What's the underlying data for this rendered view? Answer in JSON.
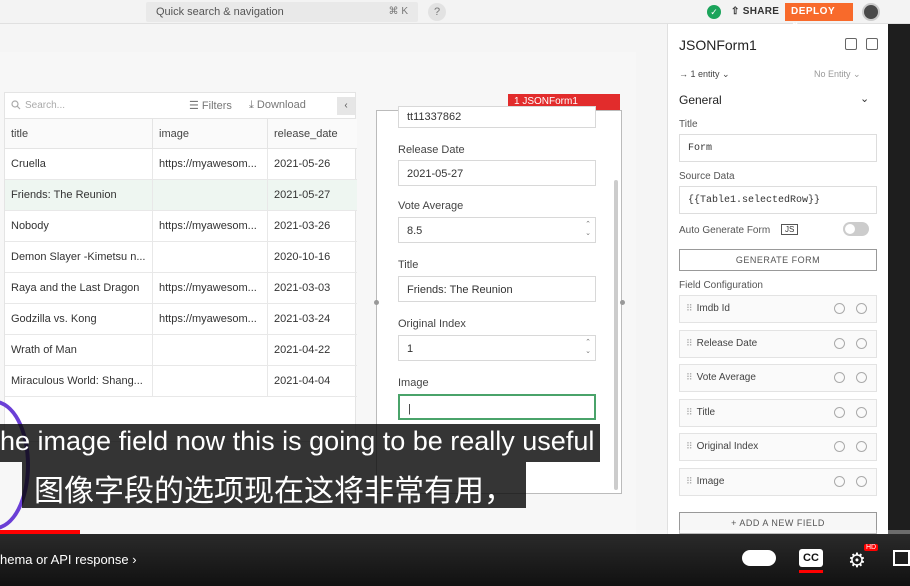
{
  "topbar": {
    "search_placeholder": "Quick search & navigation",
    "search_shortcut": "⌘ K",
    "help": "?",
    "share_label": "SHARE",
    "deploy_label": "DEPLOY"
  },
  "table": {
    "search_placeholder": "Search...",
    "filters_label": "Filters",
    "download_label": "Download",
    "columns": [
      "title",
      "image",
      "release_date"
    ],
    "rows": [
      {
        "title": "Cruella",
        "image": "https://myawesom...",
        "release_date": "2021-05-26"
      },
      {
        "title": "Friends: The Reunion",
        "image": "",
        "release_date": "2021-05-27"
      },
      {
        "title": "Nobody",
        "image": "https://myawesom...",
        "release_date": "2021-03-26"
      },
      {
        "title": "Demon Slayer -Kimetsu n...",
        "image": "",
        "release_date": "2020-10-16"
      },
      {
        "title": "Raya and the Last Dragon",
        "image": "https://myawesom...",
        "release_date": "2021-03-03"
      },
      {
        "title": "Godzilla vs. Kong",
        "image": "https://myawesom...",
        "release_date": "2021-03-24"
      },
      {
        "title": "Wrath of Man",
        "image": "",
        "release_date": "2021-04-22"
      },
      {
        "title": "Miraculous World: Shang...",
        "image": "",
        "release_date": "2021-04-04"
      }
    ],
    "selected_row_index": 1
  },
  "form": {
    "badge_label": "1  JSONForm1",
    "imdb_value": "tt11337862",
    "release_date_label": "Release Date",
    "release_date_value": "2021-05-27",
    "vote_average_label": "Vote Average",
    "vote_average_value": "8.5",
    "title_label": "Title",
    "title_value": "Friends: The Reunion",
    "original_index_label": "Original Index",
    "original_index_value": "1",
    "image_label": "Image",
    "image_value": "|"
  },
  "panel": {
    "widget_name": "JSONForm1",
    "entity_count": "1 entity",
    "no_entity": "No Entity",
    "section_general": "General",
    "title_label": "Title",
    "title_value": "Form",
    "source_data_label": "Source Data",
    "source_data_value": "{{Table1.selectedRow}}",
    "auto_generate_label": "Auto Generate Form",
    "js_badge": "JS",
    "generate_button": "GENERATE FORM",
    "field_config_label": "Field Configuration",
    "fields": [
      "Imdb Id",
      "Release Date",
      "Vote Average",
      "Title",
      "Original Index",
      "Image"
    ],
    "add_field_button": "+ ADD A NEW FIELD"
  },
  "video": {
    "subtitle_en": "he image field now this is going to be really useful",
    "subtitle_zh": "图像字段的选项现在这将非常有用，",
    "chapter": "hema or API response",
    "cc_label": "CC",
    "hd_badge": "HD",
    "progress_fraction": 0.088
  },
  "colors": {
    "accent_orange": "#f86a2b",
    "success_green": "#1ba45b",
    "badge_red": "#e22c2c",
    "progress_red": "#ff0000"
  }
}
